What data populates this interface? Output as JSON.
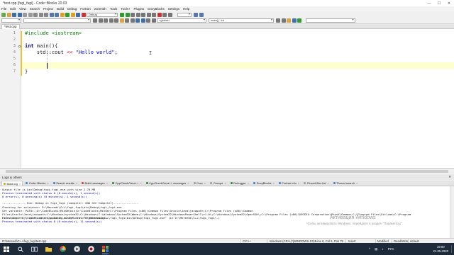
{
  "window": {
    "title": "*test.cpp [fugi_fugi] - Code::Blocks 20.03",
    "min_label": "—",
    "max_label": "☐",
    "close_label": "✕"
  },
  "menu": [
    "File",
    "Edit",
    "View",
    "Search",
    "Project",
    "Build",
    "Debug",
    "Fortran",
    "wxSmith",
    "Tools",
    "Tools+",
    "Plugins",
    "DoxyBlocks",
    "Settings",
    "Help"
  ],
  "toolbar": {
    "build_target": "Debug",
    "scope_combo": "<global>",
    "function_combo": "main() : int"
  },
  "editor": {
    "tab_label": "*test.cpp",
    "lines": [
      {
        "num": "1",
        "text": "#include <iostream>"
      },
      {
        "num": "2",
        "text": ""
      },
      {
        "num": "3",
        "text": "int main(){"
      },
      {
        "num": "4",
        "text": "    std::cout << \"Hello world\";"
      },
      {
        "num": "5",
        "text": ""
      },
      {
        "num": "6",
        "text": ""
      },
      {
        "num": "7",
        "text": "}"
      }
    ],
    "code": {
      "include_kw": "#include",
      "include_hdr": " <iostream>",
      "int_kw": "int",
      "main_sig": " main(){",
      "cout": "    std::cout ",
      "op": "<<",
      "str": " \"Hello world\"",
      "semi": ";",
      "close": "}"
    },
    "ibeam": "I"
  },
  "logs": {
    "header": "Logs & others",
    "close_label": "✕",
    "tabs": [
      {
        "label": "Build log",
        "color": "#d9a000",
        "active": true
      },
      {
        "label": "Code::Blocks",
        "color": "#3a7bd5",
        "active": false
      },
      {
        "label": "Search results",
        "color": "#3a7bd5",
        "active": false
      },
      {
        "label": "Build messages",
        "color": "#d33",
        "active": false
      },
      {
        "label": "CppCheck/Vera++",
        "color": "#2a8a2a",
        "active": false
      },
      {
        "label": "CppCheck/Vera++ messages",
        "color": "#2a8a2a",
        "active": false
      },
      {
        "label": "Cscc",
        "color": "#999",
        "active": false
      },
      {
        "label": "Cscope",
        "color": "#999",
        "active": false
      },
      {
        "label": "Debugger",
        "color": "#2a8a2a",
        "active": false
      },
      {
        "label": "DoxyBlocks",
        "color": "#3a7bd5",
        "active": false
      },
      {
        "label": "Fortran info",
        "color": "#3a7bd5",
        "active": false
      },
      {
        "label": "Closed files list",
        "color": "#999",
        "active": false
      },
      {
        "label": "Thread search",
        "color": "#3a7bd5",
        "active": false
      }
    ],
    "tab_close": "×",
    "lines": [
      {
        "text": "Output file is bin\\Debug\\fugi_fugi.exe with size 2.78 MB",
        "blue": false
      },
      {
        "text": "Process terminated with status 0 (0 minute(s), 1 second(s))",
        "blue": true
      },
      {
        "text": "0 error(s), 0 warning(s) (0 minute(s), 1 second(s))",
        "blue": true
      },
      {
        "text": "",
        "blue": false
      },
      {
        "text": "-------------- Run: Debug in fugi_fugi (compiler: GNU GCC Compiler)---------------",
        "blue": false
      },
      {
        "text": "Checking for existence: D:\\Mereedi\\C++\\fugi_fugi\\bin\\Debug\\fugi_fugi.exe",
        "blue": false
      },
      {
        "text": "Set variable: PATH=.;D:\\CodeBlocks\\MinGW\\bin;D:\\CodeBlocks\\MinGW;C:\\Program Files (x86)\\Common Files\\Oracle\\Java\\javapath;C:\\Program Files (x86)\\Common Files\\Oracle\\Java\\javapath;C:\\Windows\\system32;C:\\Windows;C:\\Windows\\System32\\Wbem;C:\\Windows\\System32\\WindowsPowerShell\\v1.0\\;C:\\Windows\\System32\\OpenSSH\\;C:\\Program Files (x86)\\NVIDIA Corporation\\PhysX\\Common;C:\\Program Files\\Git\\cmd;C:\\Program Files\\dotnet\\;C:\\Users\\User\\AppData\\Local\\Microsoft\\WindowsApps",
        "blue": false
      },
      {
        "text": "Executing: \"D:\\CodeBlocks/cb_console_runner.exe\" \"D:\\Mereedi\\C++\\fugi_fugi\\bin\\Debug\\fugi_fugi.exe\"  (in D:\\Mereedi\\C++\\fugi_fugi\\.)",
        "blue": false
      },
      {
        "text": "Process terminated with status 0 (0 minute(s), 11 second(s))",
        "blue": true
      }
    ]
  },
  "watermark": {
    "line1": "Активация Windows",
    "line2": "Чтобы активировать Windows, перейдите в раздел \"Параметры\"."
  },
  "status": {
    "path": "D:\\Mereedi\\C++\\fugi_fugi\\test.cpp",
    "lang": "C/C++",
    "eol": "Windows (CR+LF)",
    "encoding": "WINDOWS-1251",
    "position": "Line 6, Col 5, Pos 78",
    "mode": "Insert",
    "modified": "Modified",
    "rw": "Read/Write",
    "profile": "default"
  },
  "taskbar": {
    "lang": "РУС",
    "time": "19:00",
    "date": "21.05.2020"
  }
}
